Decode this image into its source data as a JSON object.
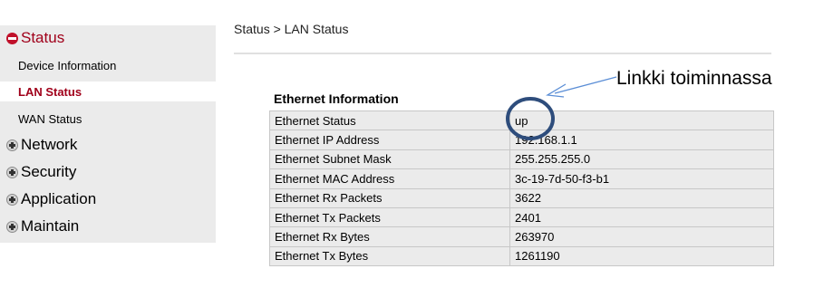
{
  "sidebar": {
    "status": {
      "label": "Status",
      "icon": "minus-circle-icon"
    },
    "status_items": [
      {
        "label": "Device Information"
      },
      {
        "label": "LAN Status"
      },
      {
        "label": "WAN Status"
      }
    ],
    "sections": [
      {
        "label": "Network",
        "icon": "plus-circle-icon"
      },
      {
        "label": "Security",
        "icon": "plus-circle-icon"
      },
      {
        "label": "Application",
        "icon": "plus-circle-icon"
      },
      {
        "label": "Maintain",
        "icon": "plus-circle-icon"
      }
    ],
    "active_color": "#a0001a"
  },
  "main": {
    "breadcrumb": "Status > LAN Status",
    "section_title": "Ethernet Information",
    "rows": [
      {
        "label": "Ethernet Status",
        "value": "up"
      },
      {
        "label": "Ethernet IP Address",
        "value": "192.168.1.1"
      },
      {
        "label": "Ethernet Subnet Mask",
        "value": "255.255.255.0"
      },
      {
        "label": "Ethernet MAC Address",
        "value": "3c-19-7d-50-f3-b1"
      },
      {
        "label": "Ethernet Rx Packets",
        "value": "3622"
      },
      {
        "label": "Ethernet Tx Packets",
        "value": "2401"
      },
      {
        "label": "Ethernet Rx Bytes",
        "value": "263970"
      },
      {
        "label": "Ethernet Tx Bytes",
        "value": "1261190"
      }
    ]
  },
  "annotation": {
    "text": "Linkki toiminnassa",
    "circle_color": "#2e4d7c",
    "arrow_color": "#5b8ed6"
  }
}
